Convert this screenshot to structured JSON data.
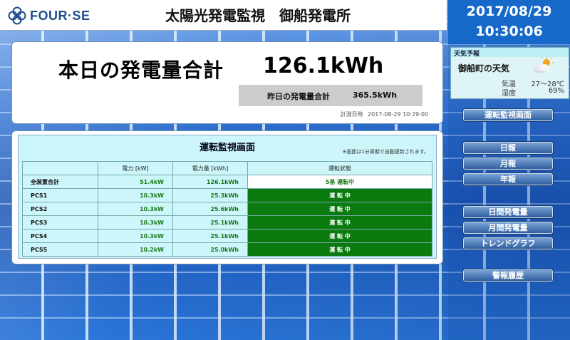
{
  "header": {
    "logo_text": "FOUR·SE",
    "title": "太陽光発電監視　御船発電所"
  },
  "clock": {
    "date": "2017/08/29",
    "time": "10:30:06"
  },
  "weather": {
    "heading": "天気予報",
    "place": "御船町の天気",
    "icon": "partly-cloudy-icon",
    "temp_label": "気温",
    "temp_value": "27～28℃",
    "humidity_label": "湿度",
    "humidity_value": "69%"
  },
  "nav": {
    "monitor": "運転監視画面",
    "daily": "日報",
    "monthly": "月報",
    "yearly": "年報",
    "daily_gen": "日間発電量",
    "monthly_gen": "月間発電量",
    "trend": "トレンドグラフ",
    "alarm": "警報履歴"
  },
  "summary": {
    "label": "本日の発電量合計",
    "value": "126.1kWh",
    "yesterday_label": "昨日の発電量合計",
    "yesterday_value": "365.5kWh",
    "measured_label": "計測日時",
    "measured_value": "2017-08-29 10:29:00"
  },
  "monitor": {
    "title": "運転監視画面",
    "note": "※画面は1分周期で自動更新されます。",
    "headers": [
      "",
      "電力 [kW]",
      "電力量 [kWh]",
      "運転状態"
    ],
    "rows": [
      {
        "name": "全装置合計",
        "power": "51.4kW",
        "energy": "126.1kWh",
        "status": "5基 運転中"
      },
      {
        "name": "PCS1",
        "power": "10.3kW",
        "energy": "25.3kWh",
        "status": "運 転 中"
      },
      {
        "name": "PCS2",
        "power": "10.3kW",
        "energy": "25.6kWh",
        "status": "運 転 中"
      },
      {
        "name": "PCS3",
        "power": "10.3kW",
        "energy": "25.1kWh",
        "status": "運 転 中"
      },
      {
        "name": "PCS4",
        "power": "10.3kW",
        "energy": "25.1kWh",
        "status": "運 転 中"
      },
      {
        "name": "PCS5",
        "power": "10.2kW",
        "energy": "25.0kWh",
        "status": "運 転 中"
      }
    ]
  },
  "colors": {
    "running": "#0b7b10",
    "value_green": "#1b7a1b",
    "clock_bg": "#1669c9"
  }
}
